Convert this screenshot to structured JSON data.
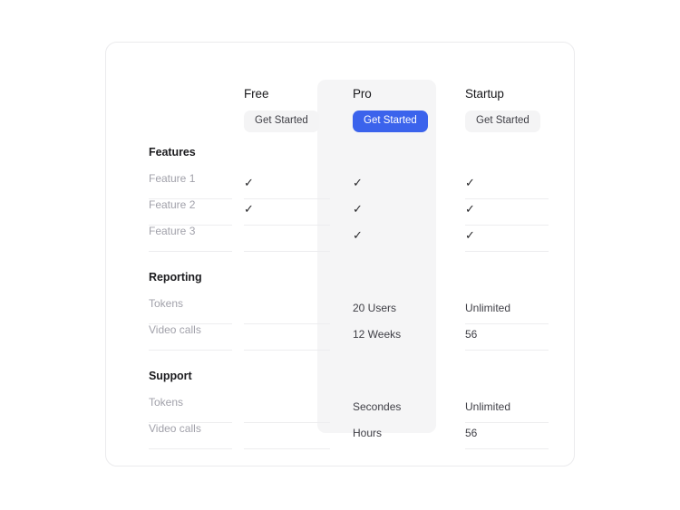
{
  "card": {
    "plans": [
      {
        "name": "Free",
        "cta_label": "Get Started",
        "highlighted": false
      },
      {
        "name": "Pro",
        "cta_label": "Get Started",
        "highlighted": true
      },
      {
        "name": "Startup",
        "cta_label": "Get Started",
        "highlighted": false
      }
    ],
    "sections": [
      {
        "title": "Features",
        "rows": [
          {
            "label": "Feature 1",
            "free": "check",
            "pro": "check",
            "startup": "check"
          },
          {
            "label": "Feature 2",
            "free": "check",
            "pro": "check",
            "startup": "check"
          },
          {
            "label": "Feature 3",
            "free": "",
            "pro": "check",
            "startup": "check"
          }
        ]
      },
      {
        "title": "Reporting",
        "rows": [
          {
            "label": "Tokens",
            "free": "",
            "pro": "20 Users",
            "startup": "Unlimited"
          },
          {
            "label": "Video calls",
            "free": "",
            "pro": "12 Weeks",
            "startup": "56"
          }
        ]
      },
      {
        "title": "Support",
        "rows": [
          {
            "label": "Tokens",
            "free": "",
            "pro": "Secondes",
            "startup": "Unlimited"
          },
          {
            "label": "Video calls",
            "free": "",
            "pro": "Hours",
            "startup": "56"
          }
        ]
      }
    ],
    "icons": {
      "check_glyph": "✓"
    },
    "colors": {
      "primary_cta": "#3b63ec",
      "secondary_cta": "#f4f4f5",
      "highlight_panel": "#f5f5f6",
      "card_border": "#ebebed",
      "divider": "#ededef",
      "muted_text": "#a1a1aa",
      "strong_text": "#18181b"
    }
  }
}
